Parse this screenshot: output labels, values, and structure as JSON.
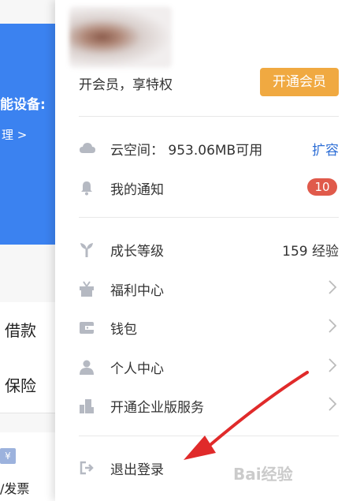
{
  "background": {
    "title": "能设备:",
    "link": "理 >",
    "rows": [
      "借款",
      "保险"
    ],
    "yen_icon": "¥",
    "invoice": "/发票"
  },
  "panel": {
    "vip_text": "开会员，享特权",
    "vip_button": "开通会员",
    "cloud": {
      "label": "云空间：  953.06MB可用",
      "action": "扩容"
    },
    "notice": {
      "label": "我的通知",
      "badge": "10"
    },
    "growth": {
      "label": "成长等级",
      "value": "159 经验"
    },
    "welfare": {
      "label": "福利中心"
    },
    "wallet": {
      "label": "钱包"
    },
    "personal": {
      "label": "个人中心"
    },
    "enterprise": {
      "label": "开通企业版服务"
    },
    "logout": {
      "label": "退出登录"
    }
  },
  "colors": {
    "accent": "#f0a941",
    "link": "#2f6fd6",
    "badge": "#e05a4b",
    "icon": "#b5b9c2",
    "annotation": "#e02a2a"
  },
  "watermark": "Bai经验"
}
